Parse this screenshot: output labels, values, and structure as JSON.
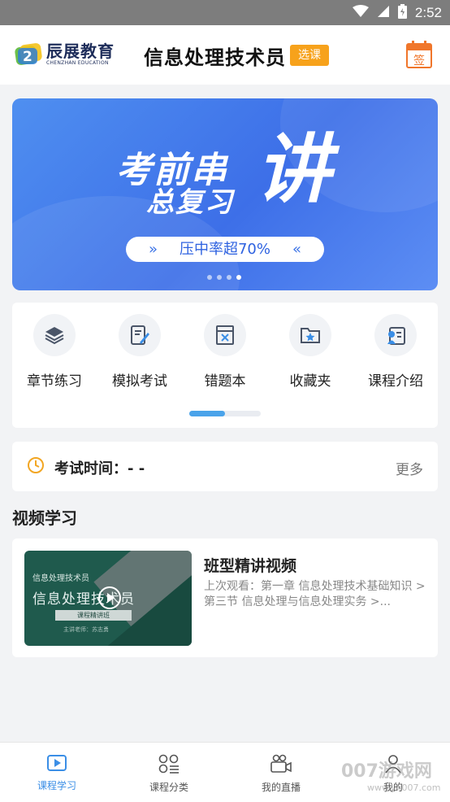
{
  "status_bar": {
    "time": "2:52"
  },
  "header": {
    "logo_cn": "辰展教育",
    "logo_en": "CHENZHAN EDUCATION",
    "course_title": "信息处理技术员",
    "select_label": "选课",
    "calendar_label": "签"
  },
  "banner": {
    "line1": "考前串",
    "line2": "总复习",
    "big_char": "讲",
    "pill_text": "压中率超70%",
    "pill_left": "»",
    "pill_right": "«",
    "page_count": 4,
    "active_page": 3
  },
  "menu": {
    "items": [
      {
        "label": "章节练习",
        "icon": "layers-icon"
      },
      {
        "label": "模拟考试",
        "icon": "edit-document-icon"
      },
      {
        "label": "错题本",
        "icon": "wrong-book-icon"
      },
      {
        "label": "收藏夹",
        "icon": "favorite-folder-icon"
      },
      {
        "label": "课程介绍",
        "icon": "course-intro-icon"
      }
    ],
    "scroll_progress": 0.5
  },
  "exam": {
    "label": "考试时间：- -",
    "more": "更多"
  },
  "video_section": {
    "title": "视频学习",
    "card": {
      "thumb_line1": "信息处理技术员",
      "thumb_line2": "信息处理技术员",
      "thumb_line3": "课程精讲班",
      "thumb_line4": "主讲老师：苏志勇",
      "title": "班型精讲视频",
      "desc": "上次观看：第一章 信息处理技术基础知识 > 第三节 信息处理与信息处理实务 >..."
    }
  },
  "bottom_nav": {
    "items": [
      {
        "label": "课程学习",
        "icon": "play-square-icon",
        "active": true
      },
      {
        "label": "课程分类",
        "icon": "category-icon",
        "active": false
      },
      {
        "label": "我的直播",
        "icon": "live-camera-icon",
        "active": false
      },
      {
        "label": "我的",
        "icon": "profile-icon",
        "active": false
      }
    ]
  },
  "watermark": {
    "text": "007游戏网",
    "url": "www.yx007.com"
  },
  "colors": {
    "accent": "#3a8ee6",
    "orange": "#f7a21b",
    "banner_blue": "#3d6fe8"
  }
}
